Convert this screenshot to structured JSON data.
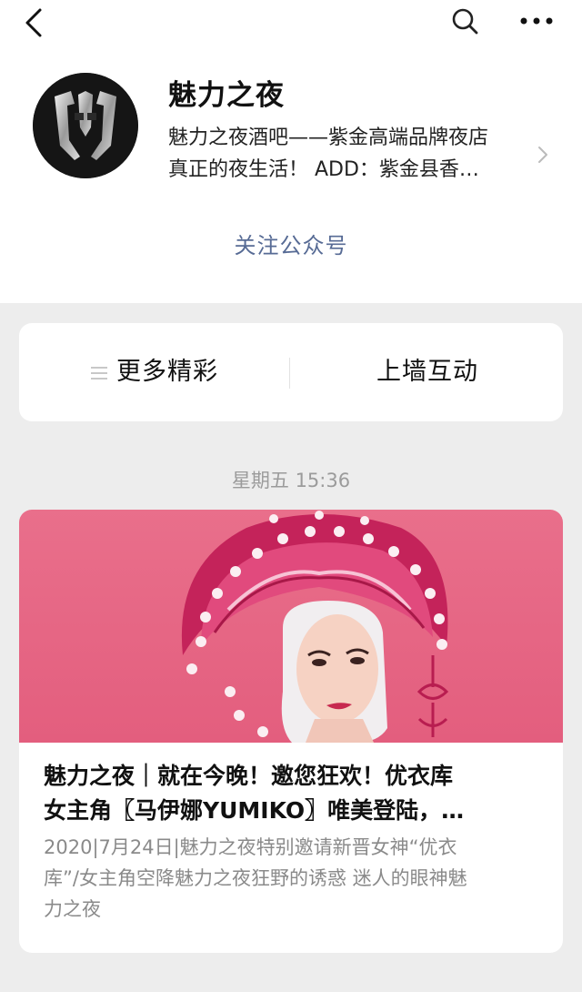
{
  "account": {
    "name": "魅力之夜",
    "desc_line1": "魅力之夜酒吧——紫金高端品牌夜店",
    "desc_line2": "真正的夜生活！ ADD：紫金县香…",
    "follow_label": "关注公众号"
  },
  "menu": {
    "left_label": "更多精彩",
    "right_label": "上墙互动"
  },
  "timestamp": "星期五 15:36",
  "article": {
    "title_line1": "魅力之夜｜就在今晚！邀您狂欢！优衣库",
    "title_line2": "女主角〖马伊娜YUMIKO〗唯美登陆，…",
    "summary_line1": "2020|7月24日|魅力之夜特别邀请新晋女神“优衣",
    "summary_line2": "库”/女主角空降魅力之夜狂野的诱惑 迷人的眼神魅",
    "summary_line3": "力之夜"
  },
  "colors": {
    "link": "#576b95",
    "background": "#ededed",
    "cover_pink": "#e96f8b"
  },
  "icons": [
    "back-icon",
    "search-icon",
    "more-icon",
    "chevron-right-icon",
    "menu-lines-icon"
  ]
}
